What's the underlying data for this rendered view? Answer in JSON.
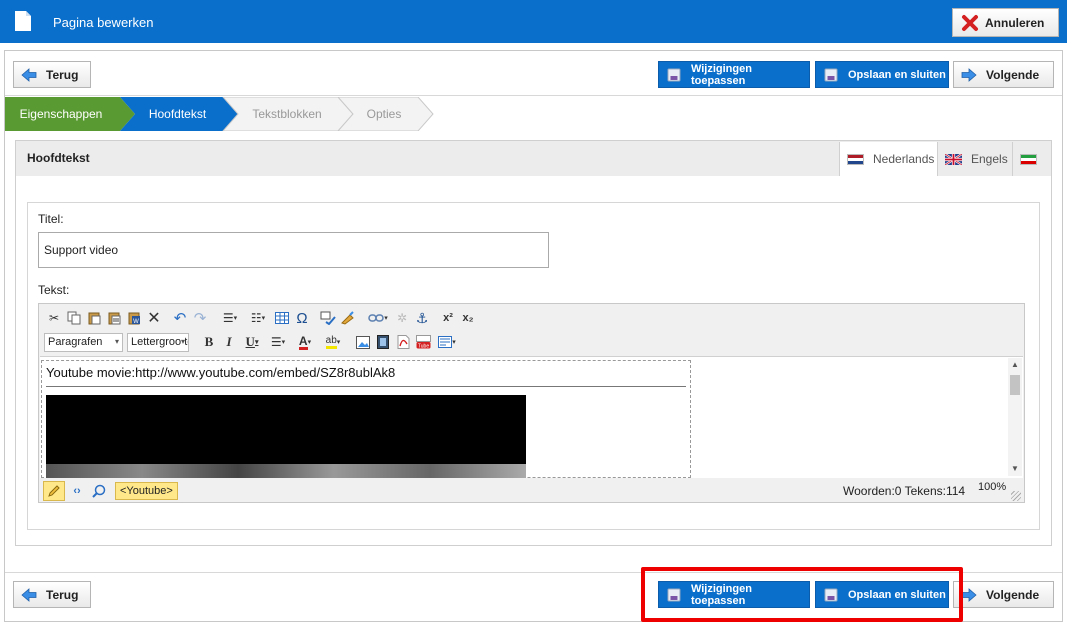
{
  "window": {
    "title": "Pagina bewerken",
    "cancel_label": "Annuleren"
  },
  "toolbar_top": {
    "back_label": "Terug",
    "apply_label": "Wijzigingen toepassen",
    "save_close_label": "Opslaan en sluiten",
    "next_label": "Volgende"
  },
  "toolbar_bottom": {
    "back_label": "Terug",
    "apply_label": "Wijzigingen toepassen",
    "save_close_label": "Opslaan en sluiten",
    "next_label": "Volgende"
  },
  "steps": [
    {
      "label": "Eigenschappen",
      "state": "done"
    },
    {
      "label": "Hoofdtekst",
      "state": "active"
    },
    {
      "label": "Tekstblokken",
      "state": "pending"
    },
    {
      "label": "Opties",
      "state": "pending"
    }
  ],
  "section": {
    "title": "Hoofdtekst",
    "languages": [
      {
        "label": "Nederlands",
        "flag": "nl-flag"
      },
      {
        "label": "Engels",
        "flag": "uk-flag"
      },
      {
        "label": "",
        "flag": "ir-flag"
      }
    ]
  },
  "form": {
    "title_label": "Titel:",
    "title_value": "Support video",
    "text_label": "Tekst:"
  },
  "editor": {
    "format_select": "Paragrafen",
    "font_select": "Lettergrootte",
    "content_line": "Youtube movie:http://www.youtube.com/embed/SZ8r8ublAk8",
    "path_tag": "<Youtube>",
    "counts": "Woorden:0 Tekens:114",
    "zoom": "100%"
  },
  "colors": {
    "accent": "#0a6fcb",
    "step_done": "#5a9a32",
    "highlight": "#ee0000"
  }
}
